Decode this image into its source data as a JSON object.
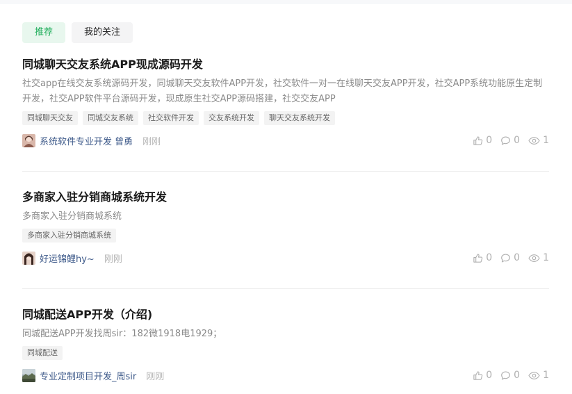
{
  "tabs": [
    {
      "label": "推荐",
      "active": true
    },
    {
      "label": "我的关注",
      "active": false
    }
  ],
  "posts": [
    {
      "title": "同城聊天交友系统APP现成源码开发",
      "summary": "社交app在线交友系统源码开发，同城聊天交友软件APP开发，社交软件一对一在线聊天交友APP开发，社交APP系统功能原生定制开发，社交APP软件平台源码开发，现成原生社交APP源码搭建，社交交友APP",
      "tags": [
        "同城聊天交友",
        "同城交友系统",
        "社交软件开发",
        "交友系统开发",
        "聊天交友系统开发"
      ],
      "author": "系统软件专业开发 曾勇",
      "time": "刚刚",
      "likes": "0",
      "comments": "0",
      "views": "1"
    },
    {
      "title": "多商家入驻分销商城系统开发",
      "summary": "多商家入驻分销商城系统",
      "tags": [
        "多商家入驻分销商城系统"
      ],
      "author": "好运锦鲤hy~",
      "time": "刚刚",
      "likes": "0",
      "comments": "0",
      "views": "1"
    },
    {
      "title": "同城配送APP开发（介绍)",
      "summary": "同城配送APP开发找周sir：182微1918电1929；",
      "tags": [
        "同城配送"
      ],
      "author": "专业定制项目开发_周sir",
      "time": "刚刚",
      "likes": "0",
      "comments": "0",
      "views": "1"
    }
  ],
  "colors": {
    "accent": "#1fae5b",
    "author": "#3e5a8a",
    "muted": "#b0b0b0"
  },
  "icons": {
    "like": "thumbs-up-icon",
    "comment": "comment-icon",
    "view": "eye-icon"
  }
}
